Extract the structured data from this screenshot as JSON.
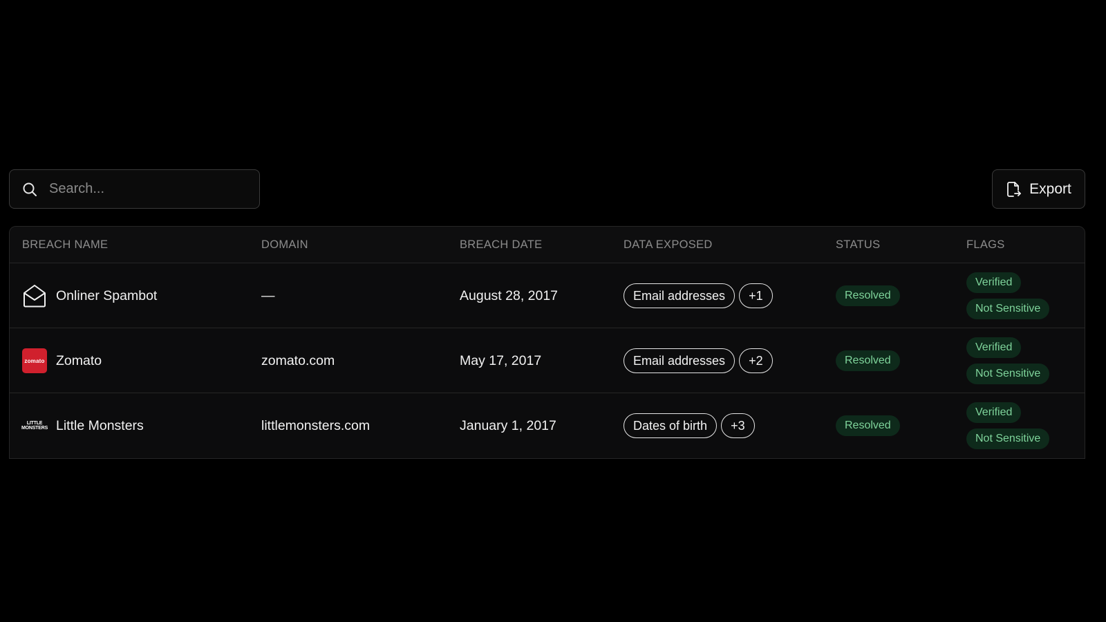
{
  "search": {
    "placeholder": "Search..."
  },
  "export": {
    "label": "Export"
  },
  "table": {
    "headers": [
      "BREACH NAME",
      "DOMAIN",
      "BREACH DATE",
      "DATA EXPOSED",
      "STATUS",
      "FLAGS"
    ],
    "rows": [
      {
        "logo": "envelope-icon",
        "name": "Onliner Spambot",
        "domain": "—",
        "date": "August 28, 2017",
        "data_exposed": "Email addresses",
        "data_more": "+1",
        "status": "Resolved",
        "flags": [
          "Verified",
          "Not Sensitive"
        ]
      },
      {
        "logo": "zomato-logo",
        "logo_text": "zomato",
        "name": "Zomato",
        "domain": "zomato.com",
        "date": "May 17, 2017",
        "data_exposed": "Email addresses",
        "data_more": "+2",
        "status": "Resolved",
        "flags": [
          "Verified",
          "Not Sensitive"
        ]
      },
      {
        "logo": "little-monsters-logo",
        "logo_text_top": "LITTLE",
        "logo_text_bottom": "MONSTERS",
        "name": "Little Monsters",
        "domain": "littlemonsters.com",
        "date": "January 1, 2017",
        "data_exposed": "Dates of birth",
        "data_more": "+3",
        "status": "Resolved",
        "flags": [
          "Verified",
          "Not Sensitive"
        ]
      }
    ]
  },
  "colors": {
    "background": "#000000",
    "status_bg": "#0e2a1b",
    "status_text": "#7fd49b",
    "zomato_red": "#d0202d"
  }
}
